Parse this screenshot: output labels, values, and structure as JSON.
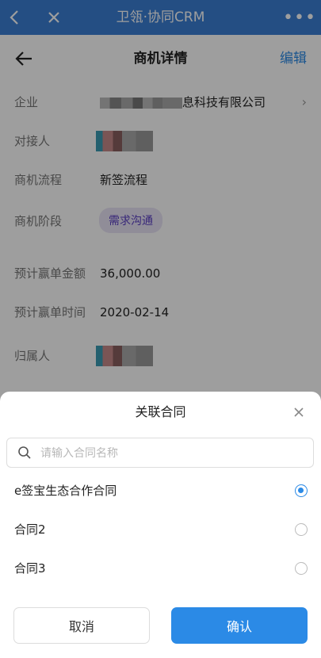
{
  "app": {
    "title": "卫瓴·协同CRM",
    "more_label": "•••"
  },
  "header": {
    "title": "商机详情",
    "edit_label": "编辑"
  },
  "fields": {
    "company_label": "企业",
    "company_value_visible": "息科技有限公司",
    "contact_label": "对接人",
    "flow_label": "商机流程",
    "flow_value": "新签流程",
    "stage_label": "商机阶段",
    "stage_value": "需求沟通",
    "amount_label": "预计赢单金额",
    "amount_value": "36,000.00",
    "date_label": "预计赢单时间",
    "date_value": "2020-02-14",
    "owner_label": "归属人"
  },
  "sheet": {
    "title": "关联合同",
    "search_placeholder": "请输入合同名称",
    "options": [
      {
        "label": "e签宝生态合作合同",
        "selected": true
      },
      {
        "label": "合同2",
        "selected": false
      },
      {
        "label": "合同3",
        "selected": false
      }
    ],
    "cancel_label": "取消",
    "confirm_label": "确认"
  },
  "colors": {
    "topbar": "#3b7ed3",
    "accent": "#2b8ae6",
    "tag_bg": "#e8e4f6",
    "tag_text": "#5b3fc4"
  }
}
